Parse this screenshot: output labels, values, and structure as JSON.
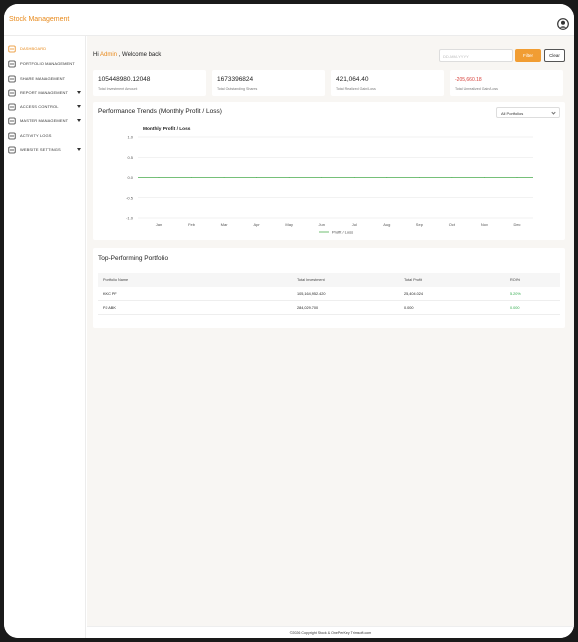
{
  "app": {
    "title": "Stock Management"
  },
  "sidebar": {
    "items": [
      {
        "label": "DASHBOARD",
        "icon": "dashboard-icon",
        "active": true,
        "has_caret": false
      },
      {
        "label": "PORTFOLIO MANAGEMENT",
        "icon": "portfolio-icon",
        "active": false,
        "has_caret": false
      },
      {
        "label": "SHARE MANAGEMENT",
        "icon": "share-icon",
        "active": false,
        "has_caret": false
      },
      {
        "label": "REPORT MANAGEMENT",
        "icon": "report-icon",
        "active": false,
        "has_caret": true
      },
      {
        "label": "ACCESS CONTROL",
        "icon": "access-control-icon",
        "active": false,
        "has_caret": true
      },
      {
        "label": "MASTER MANAGEMENT",
        "icon": "master-icon",
        "active": false,
        "has_caret": true
      },
      {
        "label": "ACTIVITY LOGS",
        "icon": "activity-icon",
        "active": false,
        "has_caret": false
      },
      {
        "label": "WEBSITE SETTINGS",
        "icon": "settings-icon",
        "active": false,
        "has_caret": true
      }
    ]
  },
  "header": {
    "greeting_prefix": "Hi ",
    "user_name": "Admin",
    "greeting_suffix": " , Welcome back",
    "date_placeholder": "DD-MM-YYYY",
    "filter_label": "Filter",
    "clear_label": "Clear"
  },
  "stats": [
    {
      "value": "105448980.12048",
      "label": "Total Investment Amount",
      "negative": false
    },
    {
      "value": "1673396824",
      "label": "Total Outstanding Shares",
      "negative": false
    },
    {
      "value": "421,064.40",
      "label": "Total Realized Gain/Loss",
      "negative": false
    },
    {
      "value": "-205,660.18",
      "label": "Total Unrealized Gain/Loss",
      "negative": true
    }
  ],
  "performance": {
    "title": "Performance Trends (Monthly Profit / Loss)",
    "portfolio_select": "All Portfolios"
  },
  "chart_data": {
    "type": "line",
    "title": "Monthly Profit / Loss",
    "categories": [
      "Jan",
      "Feb",
      "Mar",
      "Apr",
      "May",
      "Jun",
      "Jul",
      "Aug",
      "Sep",
      "Oct",
      "Nov",
      "Dec"
    ],
    "series": [
      {
        "name": "Profit / Loss",
        "values": [
          0,
          0,
          0,
          0,
          0,
          0,
          0,
          0,
          0,
          0,
          0,
          0
        ],
        "color": "#4caf50"
      }
    ],
    "yticks": [
      "1.0",
      "0.5",
      "0.0",
      "-0.5",
      "-1.0"
    ],
    "ylim": [
      -1.0,
      1.0
    ],
    "grid": true,
    "legend": "bottom"
  },
  "top_portfolio": {
    "title": "Top-Performing Portfolio",
    "columns": [
      "Portfolio Name",
      "Total Investment",
      "Total Profit",
      "ROI%"
    ],
    "rows": [
      [
        "KKC PF",
        "105,164,952.420",
        "25,404.024",
        "5.20%"
      ],
      [
        "PJ ABK",
        "284,029.700",
        "0.000",
        "0.000"
      ]
    ]
  },
  "footer": {
    "text": "©2026 Copyright Stock & OnePerKey Trimsoft.com"
  },
  "colors": {
    "accent": "#e8891a",
    "button": "#f19d33",
    "negative": "#d6403a",
    "positive": "#2eaa4a",
    "line": "#4caf50"
  }
}
